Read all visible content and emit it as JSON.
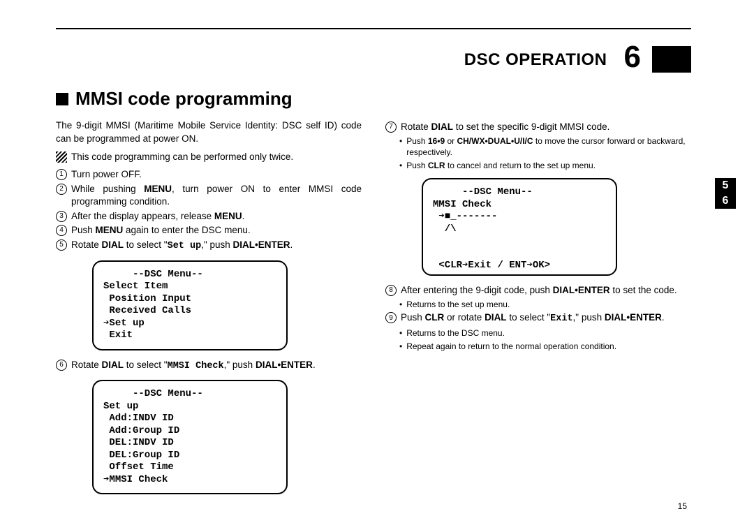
{
  "header": {
    "chapter_title": "DSC OPERATION",
    "chapter_number": "6"
  },
  "section": {
    "title": "MMSI code programming"
  },
  "tabs": {
    "a": "5",
    "b": "6"
  },
  "page_number": "15",
  "left": {
    "intro": "The 9-digit MMSI (Maritime Mobile Service Identity: DSC self ID) code can be programmed at power ON.",
    "note": "This code programming can be performed only twice.",
    "steps": {
      "1": "Turn power OFF.",
      "2a": "While pushing ",
      "2b": "MENU",
      "2c": ", turn power ON to enter MMSI code programming condition.",
      "3a": "After the display appears, release ",
      "3b": "MENU",
      "3c": ".",
      "4a": "Push ",
      "4b": "MENU",
      "4c": " again to enter the DSC menu.",
      "5a": "Rotate ",
      "5b": "DIAL",
      "5c": " to select \"",
      "5d": "Set up",
      "5e": ",\" push ",
      "5f": "DIAL•ENTER",
      "5g": ".",
      "6a": "Rotate ",
      "6b": "DIAL",
      "6c": " to select \"",
      "6d": "MMSI  Check",
      "6e": ",\" push ",
      "6f": "DIAL•ENTER",
      "6g": "."
    },
    "lcd1": "     --DSC Menu--\nSelect Item\n Position Input\n Received Calls\n➔Set up\n Exit",
    "lcd2": "     --DSC Menu--\nSet up\n Add:INDV ID\n Add:Group ID\n DEL:INDV ID\n DEL:Group ID\n Offset Time\n➔MMSI Check"
  },
  "right": {
    "steps": {
      "7a": "Rotate ",
      "7b": "DIAL",
      "7c": " to set the specific 9-digit MMSI code.",
      "b1a": "Push ",
      "b1b": "16•9",
      "b1c": " or ",
      "b1d": "CH/WX•DUAL•U/I/C",
      "b1e": " to move the cursor forward or backward, respectively.",
      "b2a": "Push ",
      "b2b": "CLR",
      "b2c": " to cancel and return to the set up menu.",
      "8a": "After entering the 9-digit code, push ",
      "8b": "DIAL•ENTER",
      "8c": " to set the code.",
      "b3": "Returns to the set up menu.",
      "9a": "Push ",
      "9b": "CLR",
      "9c": " or rotate ",
      "9d": "DIAL",
      "9e": " to select \"",
      "9f": "Exit",
      "9g": ",\" push ",
      "9h": "DIAL•ENTER",
      "9i": ".",
      "b4": "Returns to the DSC menu.",
      "b5": "Repeat again to return to the normal operation condition."
    },
    "lcd3": "     --DSC Menu--\nMMSI Check\n ➔■_-------\n  /\\\n\n\n <CLR➔Exit / ENT➔OK>"
  }
}
